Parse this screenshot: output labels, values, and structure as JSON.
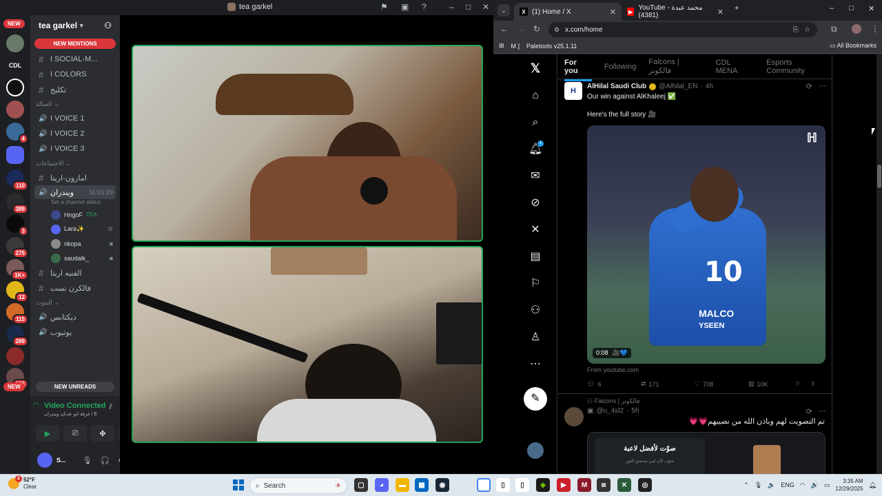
{
  "discord": {
    "window_title": "tea garkel",
    "guild_name": "tea garkel",
    "new_pill": "NEW",
    "new_mentions": "NEW MENTIONS",
    "new_unreads": "NEW UNREADS",
    "server_icon_cdl": "CDL",
    "server_badges": [
      "4",
      "110",
      "389",
      "3",
      "275",
      "1K+",
      "12",
      "115",
      "289",
      "105"
    ],
    "channels": [
      {
        "type": "text",
        "label": "I SOCIAL-M..."
      },
      {
        "type": "text",
        "label": "I COLORS"
      },
      {
        "type": "text",
        "label": "تكليج"
      }
    ],
    "category_1": "الصالة",
    "voice_channels": [
      "I VOICE 1",
      "I VOICE 2",
      "I VOICE 3"
    ],
    "category_2": "الاجتماعات",
    "extra_channel": "امازون-اريتا",
    "active_voice": {
      "label": "ويندران",
      "time": "11:01:29",
      "status": "Set a channel status"
    },
    "voice_users": [
      "HngoF",
      "Lara✨",
      "rikopa",
      "saudalk_"
    ],
    "voice_user_tag": "TEA",
    "more_channels": [
      "الفنيه اريتا",
      "فالكرن نست"
    ],
    "category_3": "البثوث",
    "stream_channels": [
      "ديكتابس",
      "يوتيوب"
    ],
    "vc_status": "Video Connected",
    "vc_sub": "غرفة ابو عدنان ويندران / E",
    "user_name": "S..."
  },
  "chrome": {
    "tabs": [
      {
        "label": "(1) Home / X",
        "active": true
      },
      {
        "label": "YouTube - محمد عبدة (4381)",
        "active": false
      }
    ],
    "url": "x.com/home",
    "bookmarks": [
      "M ]",
      "Paletools v25.1.11"
    ],
    "all_bookmarks": "All Bookmarks"
  },
  "x": {
    "tabs": [
      "For you",
      "Following",
      "Falcons | فالكونز",
      "CDL MENA",
      "Esports Community"
    ],
    "notif_count": "1",
    "tweet1": {
      "name": "AlHilal Saudi Club",
      "handle": "@Alhilal_EN",
      "time": "4h",
      "text1": "Our win against AlKhaleej ✅",
      "text2": "Here's the full story 🎥",
      "duration": "0:08",
      "media_emoji": "🎥💙",
      "jersey_number": "10",
      "jersey_name": "MALCO",
      "jersey_sponsor": "YSEEN",
      "source": "From youtube.com",
      "replies": "6",
      "reposts": "171",
      "likes": "708",
      "views": "10K"
    },
    "tweet2": {
      "context": "Falcons | فالكونز",
      "handle": "@u_4sl2",
      "time": "5h",
      "text": "تم التصويت لهم وباذن الله من نصيبهم💗💗",
      "card_title": "صوّت لأفضل لاعبة",
      "card_sub": "صوّت الآن لمن تستحق الفوز"
    }
  },
  "taskbar": {
    "weather_temp": "52°F",
    "weather_desc": "Clear",
    "weather_badge": "2",
    "search_placeholder": "Search",
    "lang": "ENG",
    "time": "3:35 AM",
    "date": "12/29/2025"
  },
  "colors": {
    "discord_green": "#23a55a",
    "x_blue": "#1d9bf0",
    "alert_red": "#da373c"
  }
}
